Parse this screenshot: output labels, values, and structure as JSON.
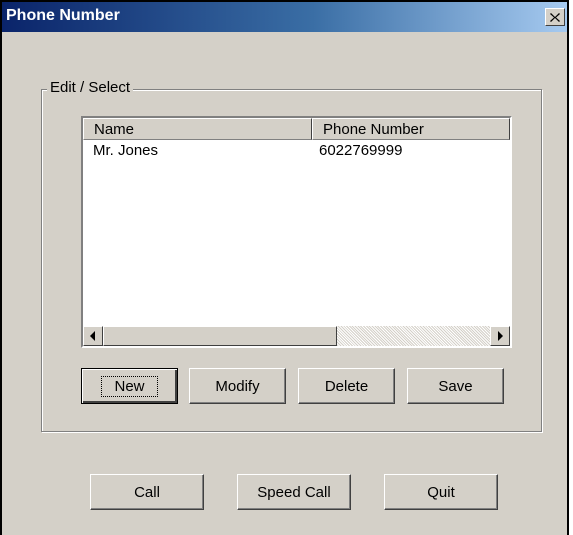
{
  "window": {
    "title": "Phone Number"
  },
  "group": {
    "label": "Edit / Select"
  },
  "list": {
    "columns": [
      "Name",
      "Phone Number"
    ],
    "rows": [
      {
        "name": "Mr. Jones",
        "phone": "6022769999"
      }
    ]
  },
  "edit_buttons": {
    "new": "New",
    "modify": "Modify",
    "delete": "Delete",
    "save": "Save"
  },
  "bottom_buttons": {
    "call": "Call",
    "speed_call": "Speed Call",
    "quit": "Quit"
  },
  "colors": {
    "face": "#d4d0c8",
    "title_start": "#0a246a",
    "title_end": "#a6caf0"
  }
}
